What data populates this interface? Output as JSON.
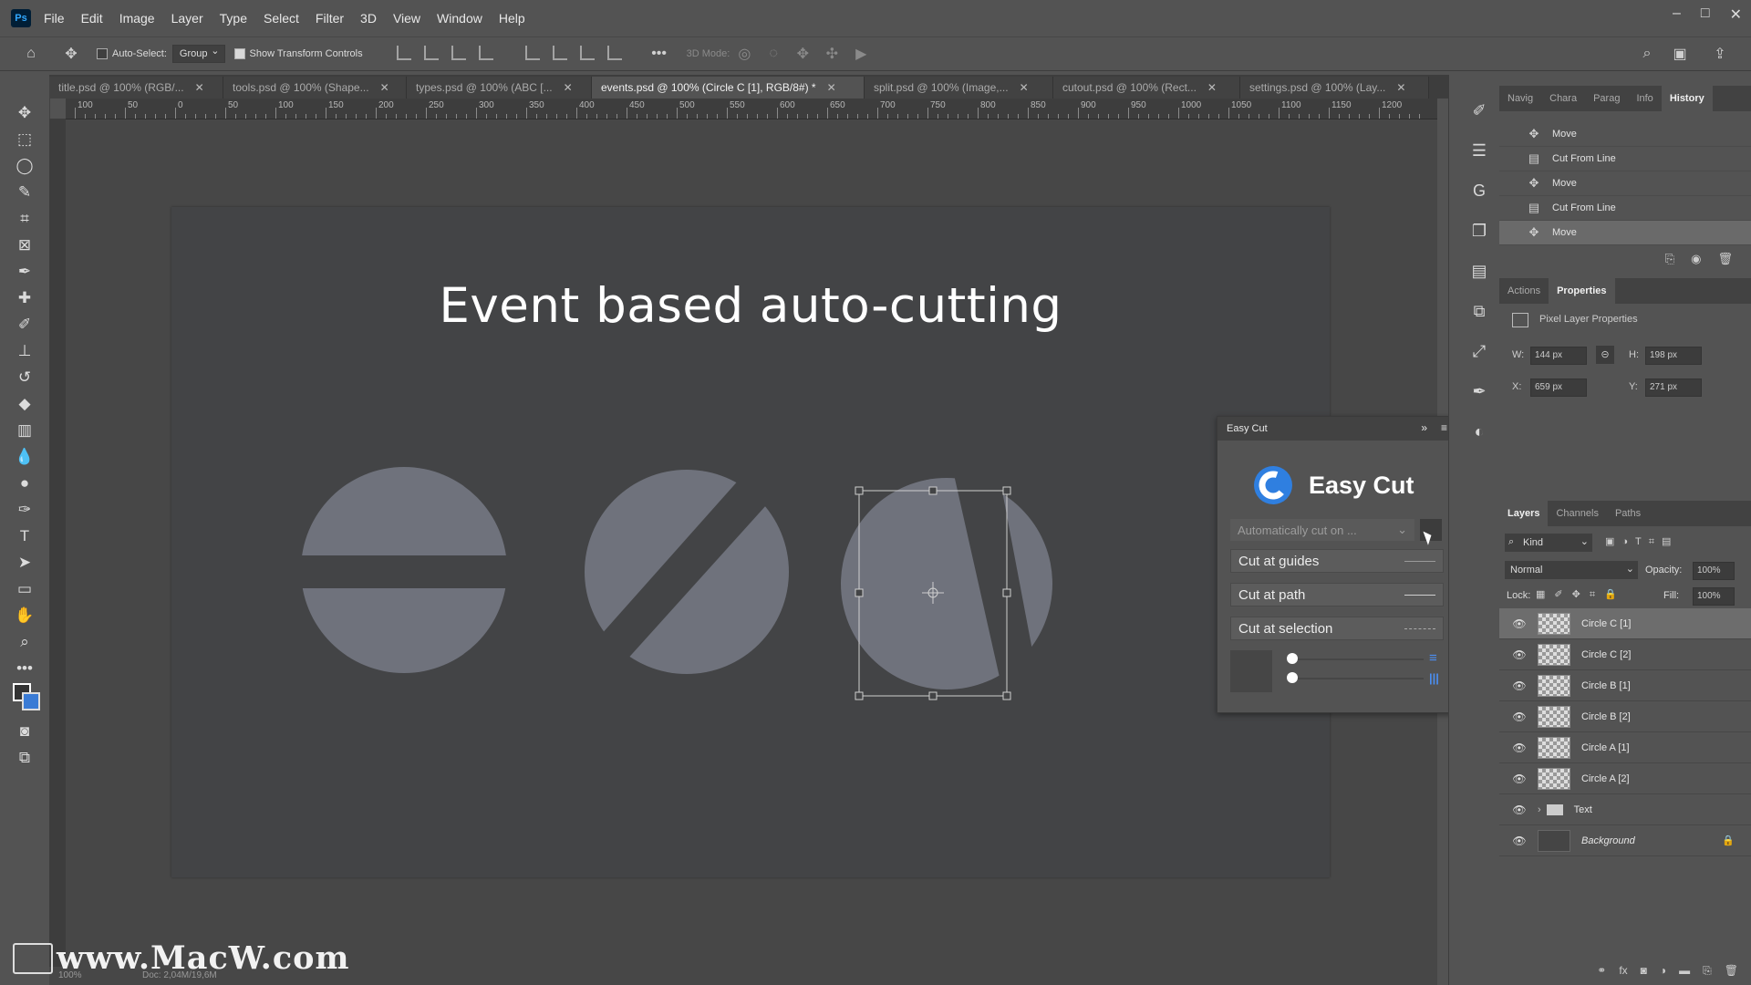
{
  "app": {
    "logo_text": "Ps"
  },
  "menu": [
    "File",
    "Edit",
    "Image",
    "Layer",
    "Type",
    "Select",
    "Filter",
    "3D",
    "View",
    "Window",
    "Help"
  ],
  "window_controls": [
    "–",
    "□",
    "✕"
  ],
  "options_bar": {
    "auto_select_label": "Auto-Select:",
    "auto_select_value": "Group",
    "show_transform_label": "Show Transform Controls",
    "mode_3d_label": "3D Mode:"
  },
  "tabs": [
    {
      "label": "title.psd @ 100% (RGB/...",
      "active": false
    },
    {
      "label": "tools.psd @ 100% (Shape...",
      "active": false
    },
    {
      "label": "types.psd @ 100% (ABC [...",
      "active": false
    },
    {
      "label": "events.psd @ 100% (Circle C [1], RGB/8#) *",
      "active": true
    },
    {
      "label": "split.psd @ 100% (Image,...",
      "active": false
    },
    {
      "label": "cutout.psd @ 100% (Rect...",
      "active": false
    },
    {
      "label": "settings.psd @ 100% (Lay...",
      "active": false
    }
  ],
  "ruler_labels": [
    "100",
    "50",
    "0",
    "50",
    "100",
    "150",
    "200",
    "250",
    "300",
    "350",
    "400",
    "450",
    "500",
    "550",
    "600",
    "650",
    "700",
    "750",
    "800",
    "850",
    "900",
    "950",
    "1000",
    "1050",
    "1100",
    "1150",
    "1200"
  ],
  "canvas": {
    "title": "Event based auto-cutting",
    "shape_color": "#6f727c",
    "bg": "#434446"
  },
  "easy_cut": {
    "header": "Easy Cut",
    "brand": "Easy Cut",
    "auto_cut_placeholder": "Automatically cut on ...",
    "buttons": [
      "Cut at guides",
      "Cut at path",
      "Cut at selection"
    ]
  },
  "panels": {
    "top_tabs": [
      "Navig",
      "Chara",
      "Parag",
      "Info",
      "History"
    ],
    "history": [
      {
        "label": "Move",
        "icon": "move-icon",
        "selected": false
      },
      {
        "label": "Cut From Line",
        "icon": "document-icon",
        "selected": false
      },
      {
        "label": "Move",
        "icon": "move-icon",
        "selected": false
      },
      {
        "label": "Cut From Line",
        "icon": "document-icon",
        "selected": false
      },
      {
        "label": "Move",
        "icon": "move-icon",
        "selected": true
      }
    ],
    "mid_tabs": [
      "Actions",
      "Properties"
    ],
    "properties": {
      "title": "Pixel Layer Properties",
      "w_label": "W:",
      "w": "144 px",
      "h_label": "H:",
      "h": "198 px",
      "x_label": "X:",
      "x": "659 px",
      "y_label": "Y:",
      "y": "271 px"
    },
    "layer_tabs": [
      "Layers",
      "Channels",
      "Paths"
    ],
    "kind_label": "Kind",
    "blend_mode": "Normal",
    "opacity_label": "Opacity:",
    "opacity": "100%",
    "lock_label": "Lock:",
    "fill_label": "Fill:",
    "fill": "100%",
    "layers": [
      {
        "name": "Circle C [1]",
        "selected": true
      },
      {
        "name": "Circle C [2]",
        "selected": false
      },
      {
        "name": "Circle B [1]",
        "selected": false
      },
      {
        "name": "Circle B [2]",
        "selected": false
      },
      {
        "name": "Circle A [1]",
        "selected": false
      },
      {
        "name": "Circle A [2]",
        "selected": false
      },
      {
        "name": "Text",
        "selected": false,
        "group": true
      },
      {
        "name": "Background",
        "selected": false,
        "background": true
      }
    ]
  },
  "status": {
    "zoom": "100%",
    "doc": "Doc: 2,04M/19,6M"
  },
  "watermark": "www.MacW.com"
}
